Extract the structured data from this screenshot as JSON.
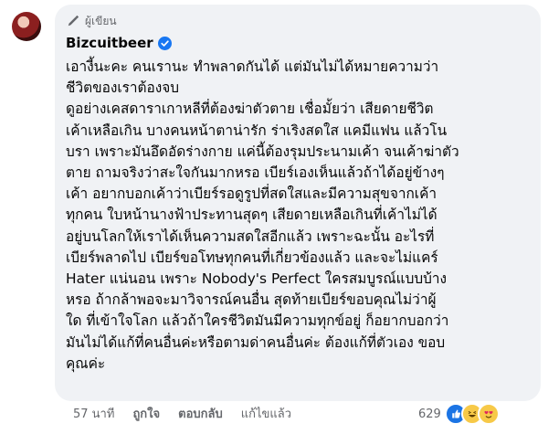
{
  "comment": {
    "badge_label": "ผู้เขียน",
    "author": "Bizcuitbeer",
    "text": "เอางี้นะคะ คนเรานะ ทำพลาดกันได้ แต่มันไม่ได้หมายความว่า\nชีวิตของเราต้องจบ\nดูอย่างเคสดาราเกาหลีที่ต้องฆ่าตัวตาย เชื่อมั้ยว่า เสียดายชีวิต\nเค้าเหลือเกิน บางคนหน้าตาน่ารัก ร่าเริงสดใส แคมีแฟน แล้วโน\nบรา เพราะมันอึดอัดร่างกาย แค่นี้ต้องรุมประนามเค้า จนเค้าฆ่าตัว\nตาย ถามจริงว่าสะใจกันมากหรอ เบียร์เองเห็นแล้วถ้าได้อยู่ข้างๆ\nเค้า อยากบอกเค้าว่าเบียร์รอดูรูปที่สดใสและมีความสุขจากเค้า\nทุกคน ใบหน้านางฟ้าประทานสุดๆ เสียดายเหลือเกินที่เค้าไม่ได้\nอยู่บนโลกให้เราได้เห็นความสดใสอีกแล้ว เพราะฉะนั้น อะไรที่\nเบียร์พลาดไป เบียร์ขอโทษทุกคนที่เกี่ยวข้องแล้ว และจะไม่แคร์\nHater แน่นอน เพราะ Nobody's Perfect ใครสมบูรณ์แบบบ้าง\nหรอ ถ้ากล้าพอจะมาวิจารณ์คนอื่น สุดท้ายเบียร์ขอบคุณไม่ว่าผู้\nใด ที่เข้าใจโลก แล้วถ้าใครชีวิตมันมีความทุกข์อยู่ ก็อยากบอกว่า\nมันไม่ได้แก้ที่คนอื่นค่ะหรือตามด่าคนอื่นค่ะ ต้องแก้ที่ตัวเอง ขอบ\nคุณค่ะ"
  },
  "footer": {
    "time": "57 นาที",
    "like_label": "ถูกใจ",
    "reply_label": "ตอบกลับ",
    "edited_label": "แก้ไขแล้ว"
  },
  "reactions": {
    "count": "629",
    "icons": [
      "like-icon",
      "haha-icon",
      "love-icon"
    ]
  },
  "colors": {
    "bubble": "#f0f2f5",
    "verified": "#1877f2",
    "meta": "#65676b"
  }
}
